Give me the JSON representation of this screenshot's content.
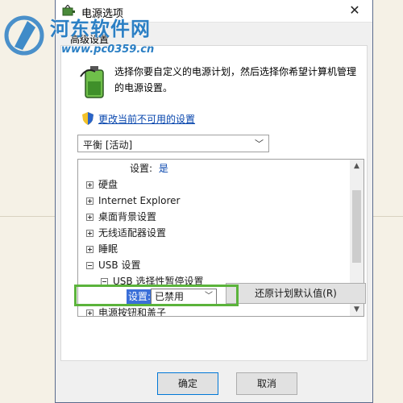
{
  "window": {
    "title": "电源选项",
    "close": "✕"
  },
  "tab": {
    "label": "高级设置"
  },
  "description": "选择你要自定义的电源计划，然后选择你希望计算机管理的电源设置。",
  "link": {
    "label": "更改当前不可用的设置"
  },
  "plan_select": {
    "value": "平衡 [活动]"
  },
  "tree": {
    "top_setting": {
      "label": "设置:",
      "value": "是"
    },
    "items": [
      {
        "label": "硬盘"
      },
      {
        "label": "Internet Explorer"
      },
      {
        "label": "桌面背景设置"
      },
      {
        "label": "无线适配器设置"
      },
      {
        "label": "睡眠"
      },
      {
        "label": "USB 设置"
      },
      {
        "label": "USB 选择性暂停设置"
      },
      {
        "label": "电源按钮和盖子"
      }
    ],
    "usb_setting": {
      "label": "设置:",
      "selected": "已禁用"
    }
  },
  "buttons": {
    "restore": "还原计划默认值(R)",
    "ok": "确定",
    "cancel": "取消"
  },
  "watermark": {
    "title": "河东软件网",
    "url": "www.pc0359.cn"
  },
  "colors": {
    "highlight": "#5bb33b",
    "selection": "#3a6fd8",
    "link": "#0645ad",
    "watermark": "#2b7fc4"
  }
}
